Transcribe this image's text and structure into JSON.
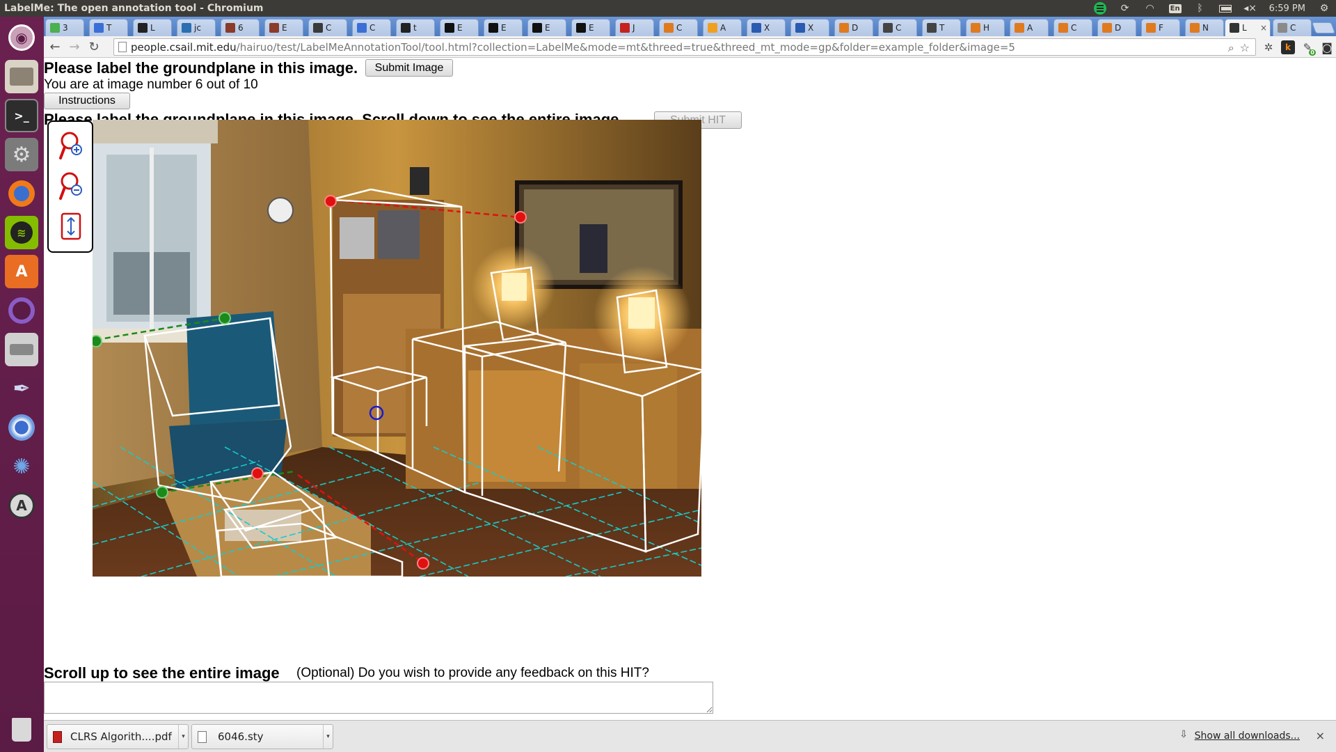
{
  "window": {
    "title": "LabelMe: The open annotation tool - Chromium",
    "clock": "6:59 PM",
    "keyboard_layout": "En"
  },
  "tabs": [
    {
      "label": "3",
      "color": "#4caf50"
    },
    {
      "label": "T",
      "color": "#3b6fd6"
    },
    {
      "label": "L",
      "color": "#222222"
    },
    {
      "label": "jc",
      "color": "#2a6fb0"
    },
    {
      "label": "6",
      "color": "#8a3b2a"
    },
    {
      "label": "E",
      "color": "#8a3b2a"
    },
    {
      "label": "C",
      "color": "#3a3a3a"
    },
    {
      "label": "C",
      "color": "#3b6fd6"
    },
    {
      "label": "t",
      "color": "#222222"
    },
    {
      "label": "E",
      "color": "#111111"
    },
    {
      "label": "E",
      "color": "#111111"
    },
    {
      "label": "E",
      "color": "#111111"
    },
    {
      "label": "E",
      "color": "#111111"
    },
    {
      "label": "J",
      "color": "#c5221f"
    },
    {
      "label": "C",
      "color": "#e07a1f"
    },
    {
      "label": "A",
      "color": "#f0a020"
    },
    {
      "label": "X",
      "color": "#2a5bb0"
    },
    {
      "label": "X",
      "color": "#2a5bb0"
    },
    {
      "label": "D",
      "color": "#e07a1f"
    },
    {
      "label": "C",
      "color": "#444444"
    },
    {
      "label": "T",
      "color": "#444444"
    },
    {
      "label": "H",
      "color": "#e07a1f"
    },
    {
      "label": "A",
      "color": "#e07a1f"
    },
    {
      "label": "C",
      "color": "#e07a1f"
    },
    {
      "label": "D",
      "color": "#e07a1f"
    },
    {
      "label": "F",
      "color": "#e07a1f"
    },
    {
      "label": "N",
      "color": "#e07a1f"
    }
  ],
  "active_tab": {
    "label": "L",
    "close": "×"
  },
  "last_tab": {
    "label": "C"
  },
  "toolbar": {
    "url_host": "people.csail.mit.edu",
    "url_rest": "/hairuo/test/LabelMeAnnotationTool/tool.html?collection=LabelMe&mode=mt&threed=true&threed_mt_mode=gp&folder=example_folder&image=5",
    "extension_k": "k",
    "extension_badge": "0"
  },
  "page": {
    "heading": "Please label the groundplane in this image.",
    "submit_image": "Submit Image",
    "status": "You are at image number 6 out of 10",
    "instructions": "Instructions",
    "heading2": "Please label the groundplane in this image. Scroll down to see the entire image.",
    "submit_hit": "Submit HIT",
    "scroll_note": "Scroll up to see the entire image",
    "feedback_question": "(Optional) Do you wish to provide any feedback on this HIT?",
    "feedback_value": ""
  },
  "downloads": [
    {
      "name": "CLRS Algorith....pdf",
      "arrow": "▾"
    },
    {
      "name": "6046.sty",
      "arrow": "▾"
    }
  ],
  "downloads_link": "Show all downloads...",
  "colors": {
    "launcher": "#5a1b44",
    "tabstrip": "#5a86c9",
    "annotation_box": "#ffffff",
    "groundplane_grid": "#19c9c9",
    "point_red": "#e01010",
    "point_green": "#1a8a1a",
    "point_blue": "#1a1ad0"
  }
}
